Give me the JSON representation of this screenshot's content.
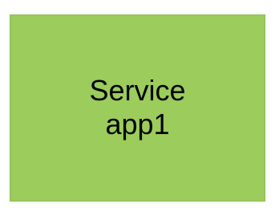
{
  "box": {
    "fill_color": "#9bcc5c",
    "label_lines": [
      "Service",
      "app1"
    ]
  }
}
